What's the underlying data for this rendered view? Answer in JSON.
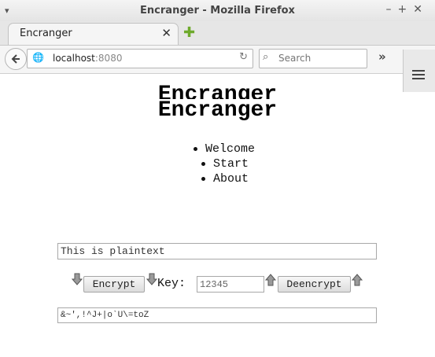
{
  "window": {
    "title": "Encranger - Mozilla Firefox",
    "menu_glyph": "▾",
    "controls": "–+✕"
  },
  "tab": {
    "label": "Encranger",
    "close": "✕",
    "newtab": "✚"
  },
  "navbar": {
    "url_host": "localhost",
    "url_port": ":8080",
    "search_placeholder": "Search",
    "overflow": "»"
  },
  "page": {
    "heading": "Encranger",
    "nav": [
      "Welcome",
      "Start",
      "About"
    ],
    "plaintext": "This is plaintext",
    "encrypt_label": "Encrypt",
    "key_label": "Key:",
    "key_value": "12345",
    "decrypt_label": "Deencrypt",
    "ciphertext": "&~',!^J+|o`U\\=toZ"
  }
}
